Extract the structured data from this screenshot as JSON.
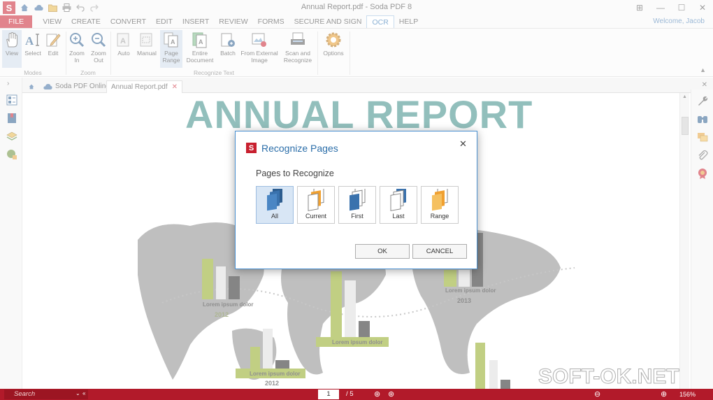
{
  "window": {
    "title": "Annual Report.pdf   -   Soda PDF 8",
    "app_logo": "S"
  },
  "quick_access": [
    "home-icon",
    "cloud-icon",
    "folder-icon",
    "print-icon",
    "undo-icon",
    "redo-icon"
  ],
  "menu": {
    "tabs": [
      "FILE",
      "VIEW",
      "CREATE",
      "CONVERT",
      "EDIT",
      "INSERT",
      "REVIEW",
      "FORMS",
      "SECURE AND SIGN",
      "OCR",
      "HELP"
    ],
    "active_tab": "OCR",
    "welcome": "Welcome, Jacob"
  },
  "ribbon": {
    "modes": {
      "label": "Modes",
      "buttons": [
        "View",
        "Select",
        "Edit"
      ]
    },
    "zoom": {
      "label": "Zoom",
      "buttons": [
        "Zoom\nIn",
        "Zoom\nOut"
      ]
    },
    "recognize": {
      "label": "Recognize Text",
      "buttons": [
        "Auto",
        "Manual",
        "Page\nRange",
        "Entire\nDocument",
        "Batch",
        "From External\nImage",
        "Scan and\nRecognize"
      ]
    },
    "options": {
      "buttons": [
        "Options"
      ]
    }
  },
  "tabs": {
    "home": "",
    "online": "Soda PDF Online",
    "document": "Annual Report.pdf"
  },
  "document": {
    "title": "ANNUAL REPORT",
    "labels": [
      {
        "text": "Lorem ipsum dolor"
      },
      {
        "text": "Lorem ipsum dolor"
      },
      {
        "text": "Lorem ipsum dolor"
      },
      {
        "text": "Lorem ipsum dolor"
      }
    ],
    "years": [
      "2012",
      "2013",
      "2012",
      "2012"
    ]
  },
  "dialog": {
    "title": "Recognize Pages",
    "subtitle": "Pages to Recognize",
    "options": [
      "All",
      "Current",
      "First",
      "Last",
      "Range"
    ],
    "selected": "All",
    "ok": "OK",
    "cancel": "CANCEL"
  },
  "status": {
    "search_placeholder": "Search",
    "page": "1",
    "total": "/ 5",
    "zoom": "156%"
  },
  "watermark": "SOFT-OK.NET",
  "colors": {
    "brand_red": "#c8202f",
    "title_teal": "#3a8a86",
    "dialog_blue": "#2b6ea9"
  }
}
